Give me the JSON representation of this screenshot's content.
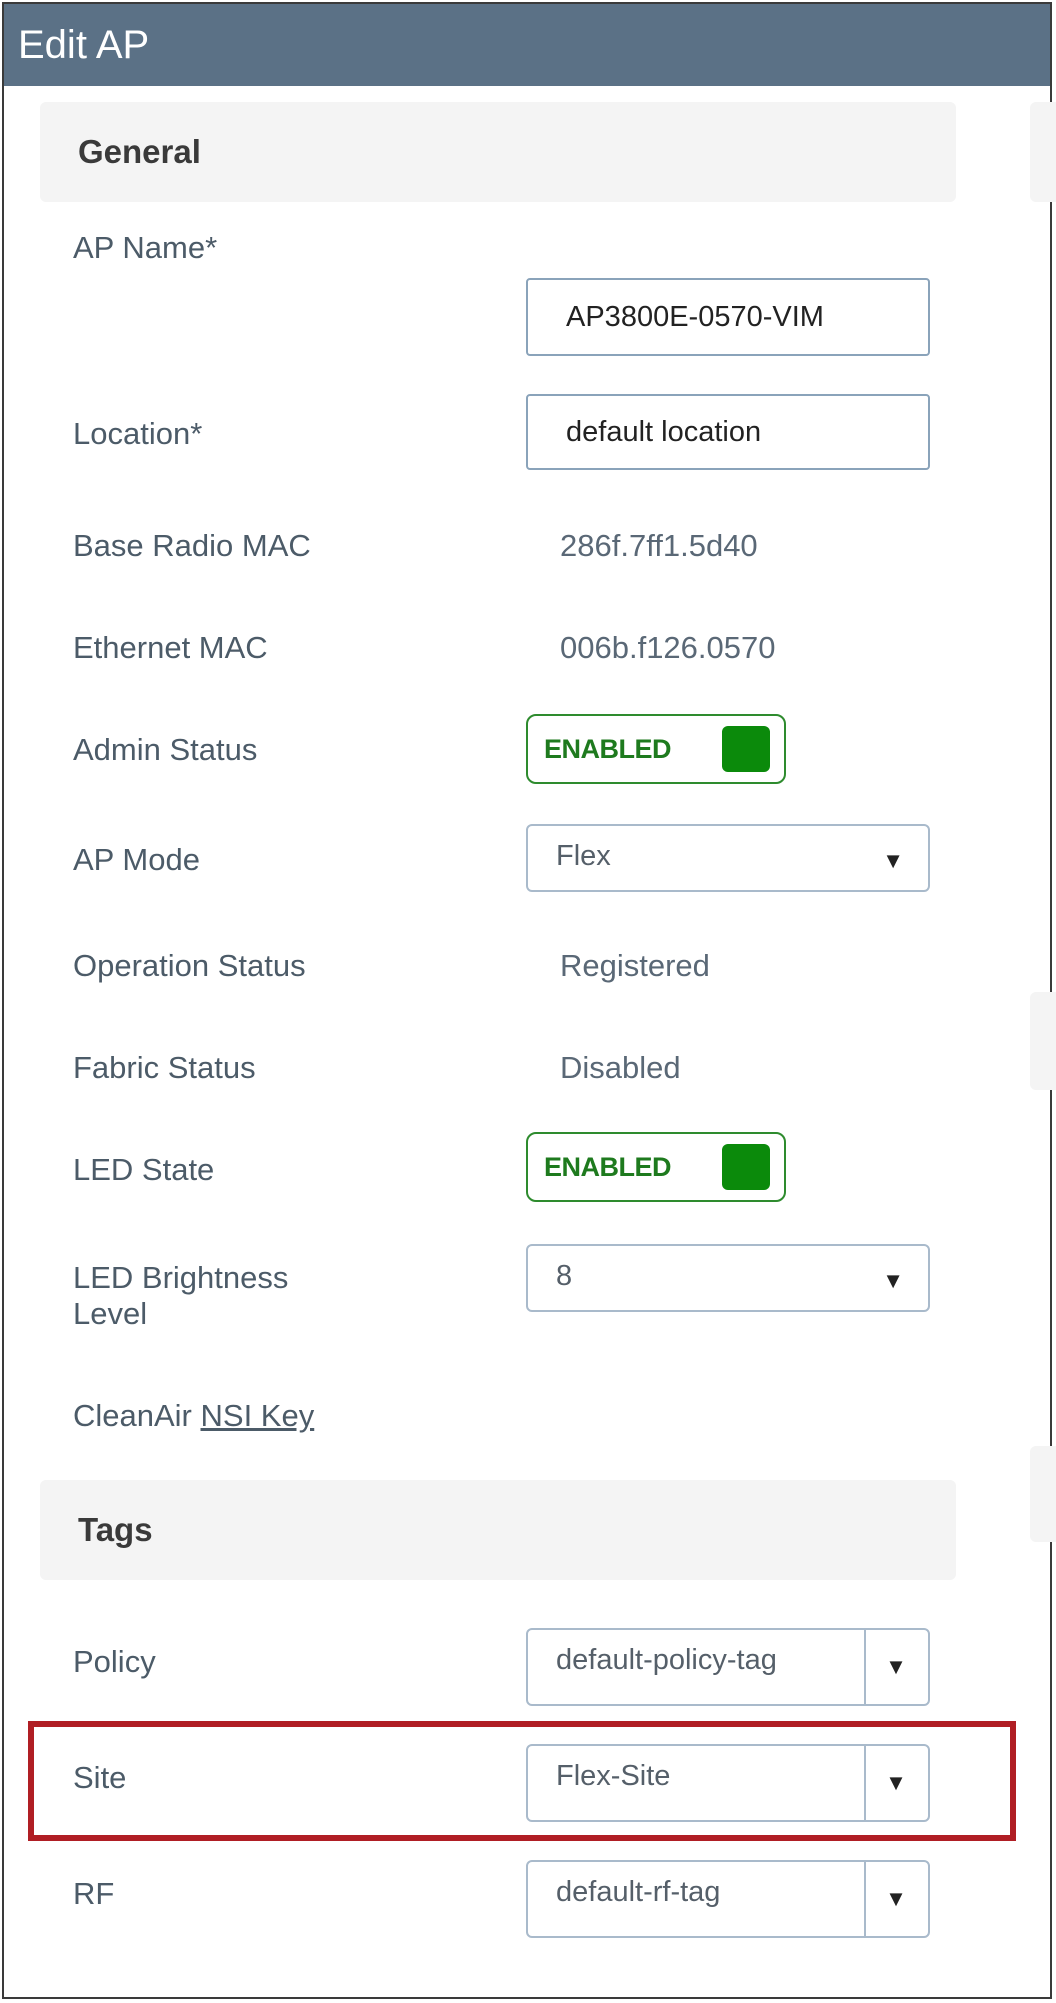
{
  "window": {
    "title": "Edit AP"
  },
  "general": {
    "heading": "General",
    "ap_name": {
      "label": "AP Name*",
      "value": "AP3800E-0570-VIM"
    },
    "location": {
      "label": "Location*",
      "value": "default location"
    },
    "base_radio_mac": {
      "label": "Base Radio MAC",
      "value": "286f.7ff1.5d40"
    },
    "ethernet_mac": {
      "label": "Ethernet MAC",
      "value": "006b.f126.0570"
    },
    "admin_status": {
      "label": "Admin Status",
      "toggle_text": "ENABLED",
      "enabled": true
    },
    "ap_mode": {
      "label": "AP Mode",
      "selected": "Flex"
    },
    "operation_status": {
      "label": "Operation Status",
      "value": "Registered"
    },
    "fabric_status": {
      "label": "Fabric Status",
      "value": "Disabled"
    },
    "led_state": {
      "label": "LED State",
      "toggle_text": "ENABLED",
      "enabled": true
    },
    "led_brightness": {
      "label_line1": "LED Brightness",
      "label_line2": "Level",
      "selected": "8"
    },
    "cleanair": {
      "label_prefix": "CleanAir",
      "link_text": "NSI Key"
    }
  },
  "tags": {
    "heading": "Tags",
    "policy": {
      "label": "Policy",
      "selected": "default-policy-tag"
    },
    "site": {
      "label": "Site",
      "selected": "Flex-Site"
    },
    "rf": {
      "label": "RF",
      "selected": "default-rf-tag"
    }
  },
  "icons": {
    "dropdown": "caret-down-icon",
    "caret_glyph": "▼"
  },
  "colors": {
    "titlebar": "#5b7186",
    "toggle_green": "#0b8a0b",
    "highlight_red": "#b01e24"
  }
}
